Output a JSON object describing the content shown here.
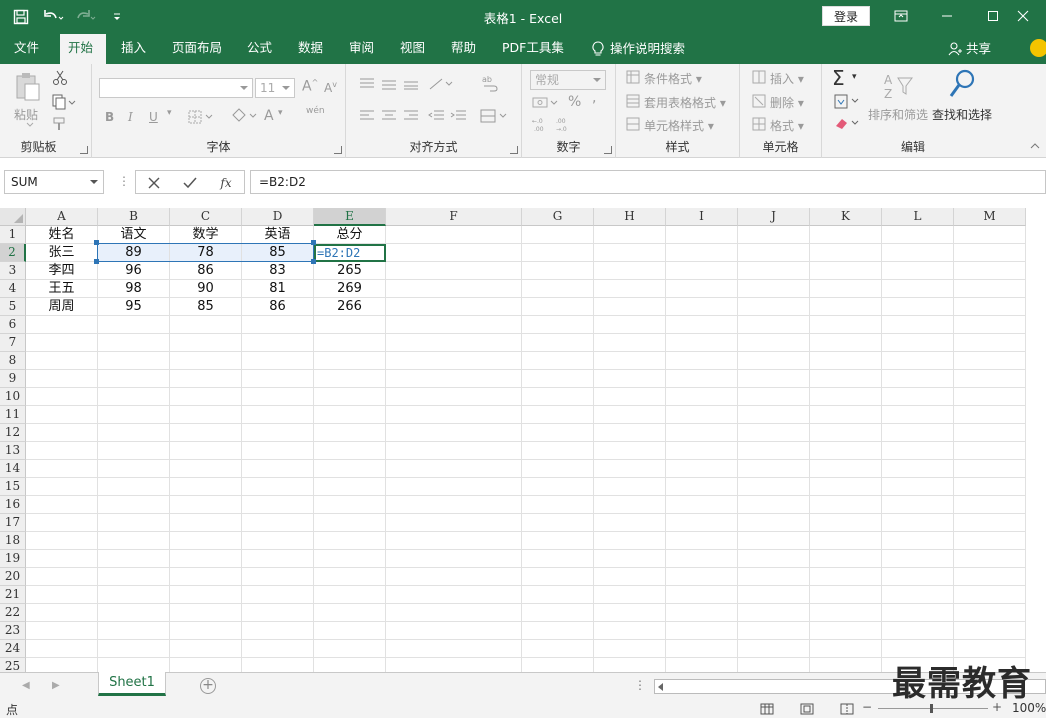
{
  "window": {
    "title": "表格1  -  Excel",
    "login_label": "登录"
  },
  "tabs": [
    "文件",
    "开始",
    "插入",
    "页面布局",
    "公式",
    "数据",
    "审阅",
    "视图",
    "帮助",
    "PDF工具集"
  ],
  "tell_me": "操作说明搜索",
  "share_label": "共享",
  "ribbon": {
    "clipboard": {
      "label": "剪贴板",
      "paste": "粘贴"
    },
    "font": {
      "label": "字体",
      "size": "11",
      "wen": "wén"
    },
    "alignment": {
      "label": "对齐方式"
    },
    "number": {
      "label": "数字",
      "format": "常规",
      "percent": "%",
      "comma": ","
    },
    "styles": {
      "label": "样式",
      "conditional": "条件格式",
      "table": "套用表格格式",
      "cell": "单元格样式"
    },
    "cells": {
      "label": "单元格",
      "insert": "插入",
      "delete": "删除",
      "format": "格式"
    },
    "editing": {
      "label": "编辑",
      "sort": "排序和筛选",
      "find": "查找和选择"
    }
  },
  "formula_bar": {
    "name_box": "SUM",
    "formula": "=B2:D2"
  },
  "columns": [
    "A",
    "B",
    "C",
    "D",
    "E",
    "F",
    "G",
    "H",
    "I",
    "J",
    "K",
    "L",
    "M"
  ],
  "rows": [
    "1",
    "2",
    "3",
    "4",
    "5",
    "6",
    "7",
    "8",
    "9",
    "10",
    "11",
    "12",
    "13",
    "14",
    "15",
    "16",
    "17",
    "18",
    "19",
    "20",
    "21",
    "22",
    "23",
    "24",
    "25"
  ],
  "cells": [
    [
      "姓名",
      "语文",
      "数学",
      "英语",
      "总分"
    ],
    [
      "张三",
      "89",
      "78",
      "85",
      "=B2:D2"
    ],
    [
      "李四",
      "96",
      "86",
      "83",
      "265"
    ],
    [
      "王五",
      "98",
      "90",
      "81",
      "269"
    ],
    [
      "周周",
      "95",
      "85",
      "86",
      "266"
    ]
  ],
  "sheet_tab": "Sheet1",
  "status_text": "点",
  "zoom": "100%",
  "watermark": "最需教育",
  "colors": {
    "accent": "#217346",
    "ref_blue": "#2e75b6"
  }
}
